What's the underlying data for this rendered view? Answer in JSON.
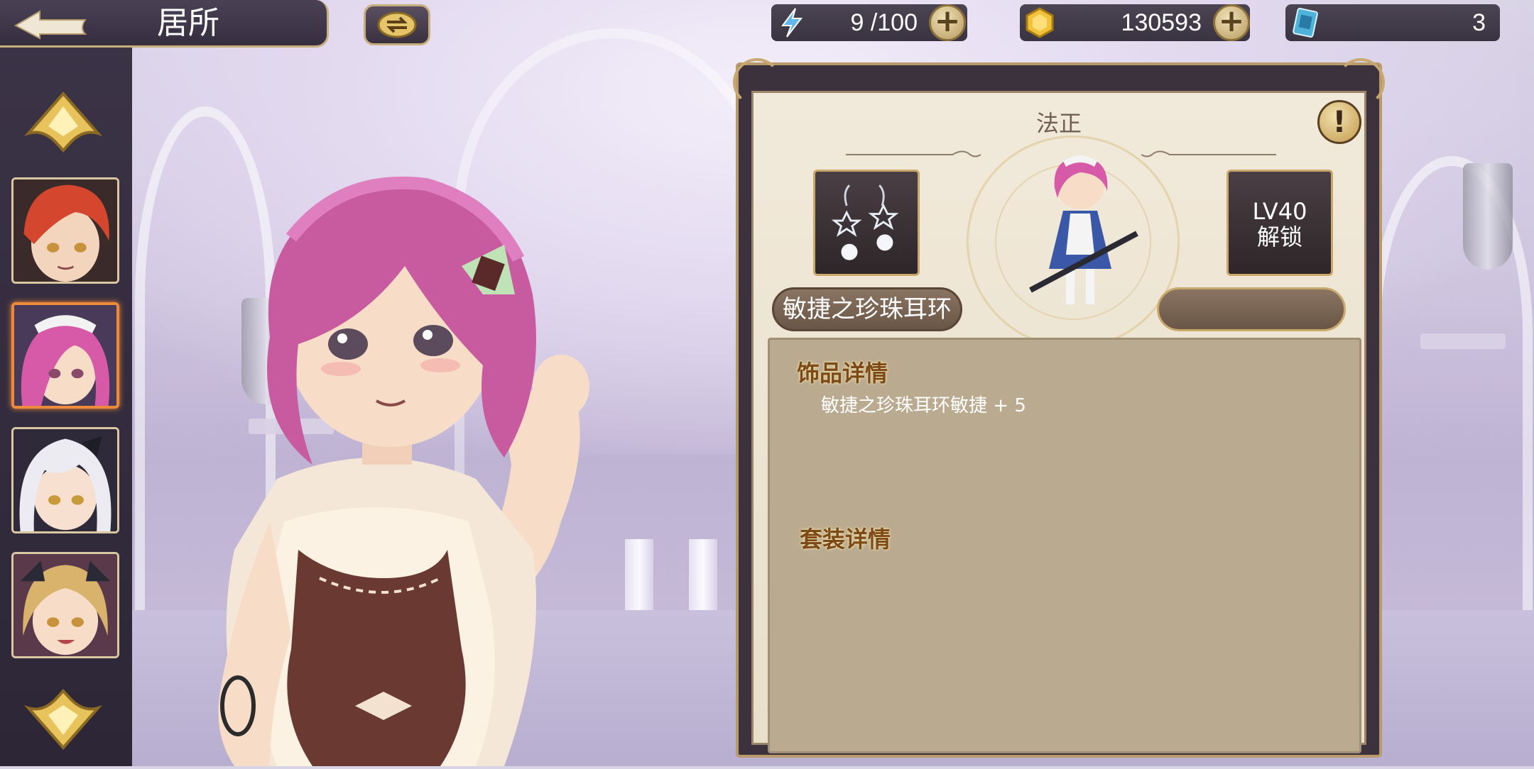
{
  "header": {
    "title": "居所",
    "back_icon": "back-arrow-icon",
    "switch_icon": "swap-arrows-icon"
  },
  "resources": {
    "stamina": {
      "icon": "lightning-icon",
      "value": "9 /100"
    },
    "gold": {
      "icon": "gold-coin-icon",
      "value": "130593"
    },
    "tickets": {
      "icon": "ticket-card-icon",
      "value": "3"
    }
  },
  "sidebar": {
    "up_icon": "arrow-up-icon",
    "down_icon": "arrow-down-icon",
    "portraits": [
      {
        "name": "portrait-red-hair",
        "selected": false,
        "hair": "#d4462e"
      },
      {
        "name": "portrait-pink-hair",
        "selected": true,
        "hair": "#d65aa8"
      },
      {
        "name": "portrait-silver-hair",
        "selected": false,
        "hair": "#ecebf1"
      },
      {
        "name": "portrait-blonde-hair",
        "selected": false,
        "hair": "#d9b36c"
      }
    ]
  },
  "panel": {
    "character_name": "法正",
    "info_icon": "exclamation-icon",
    "equipped_item_icon": "pearl-earring-icon",
    "item_name": "敏捷之珍珠耳环",
    "locked_slot": {
      "line1": "LV40",
      "line2": "解锁"
    },
    "accessory_section_title": "饰品详情",
    "accessory_detail": "敏捷之珍珠耳环敏捷 + 5",
    "set_section_title": "套装详情"
  },
  "colors": {
    "accent_gold": "#c9a86c",
    "selected_border": "#ef8a3a",
    "panel_bg": "#ece3d2",
    "detail_bg": "#b9aa90",
    "section_title": "#7b4a16"
  }
}
